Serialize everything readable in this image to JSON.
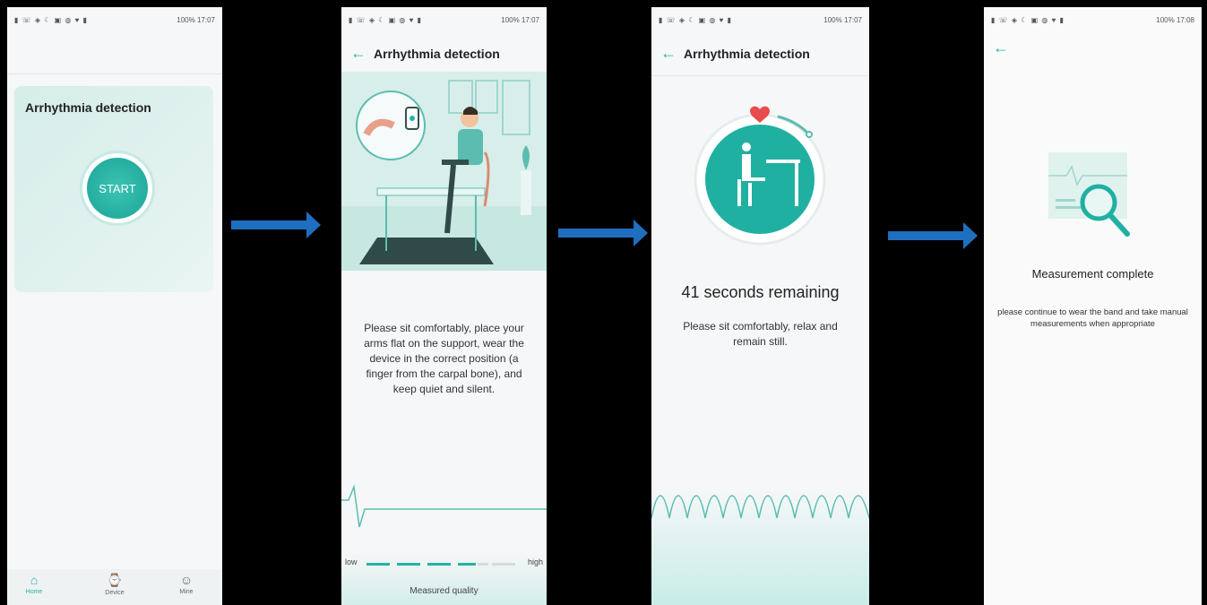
{
  "status_bar": {
    "left_icons": "▮ ☏ ◈ ☾ ▣ ◍ ♥ ▮",
    "right_time_1": "17:07",
    "right_time_4": "17:08",
    "battery": "100%"
  },
  "screen1": {
    "card_title": "Arrhythmia detection",
    "start_label": "START",
    "tabs": [
      {
        "label": "Home",
        "icon": "home-icon"
      },
      {
        "label": "Device",
        "icon": "watch-icon"
      },
      {
        "label": "Mine",
        "icon": "person-icon"
      }
    ]
  },
  "screen2": {
    "title": "Arrhythmia detection",
    "instruction": "Please sit comfortably, place your arms flat on the support, wear the device in the correct position (a finger from the carpal bone), and keep quiet and silent.",
    "quality_low": "low",
    "quality_high": "high",
    "quality_level_filled": 4,
    "quality_level_total": 6,
    "measured_quality": "Measured quality"
  },
  "screen3": {
    "title": "Arrhythmia detection",
    "remaining": "41 seconds remaining",
    "instruction": "Please sit comfortably, relax and remain still."
  },
  "screen4": {
    "complete": "Measurement complete",
    "instruction": "please continue to wear the band and take manual measurements when appropriate"
  },
  "colors": {
    "accent": "#25b3a3",
    "arrow": "#1f6fc0",
    "background": "#000000"
  }
}
